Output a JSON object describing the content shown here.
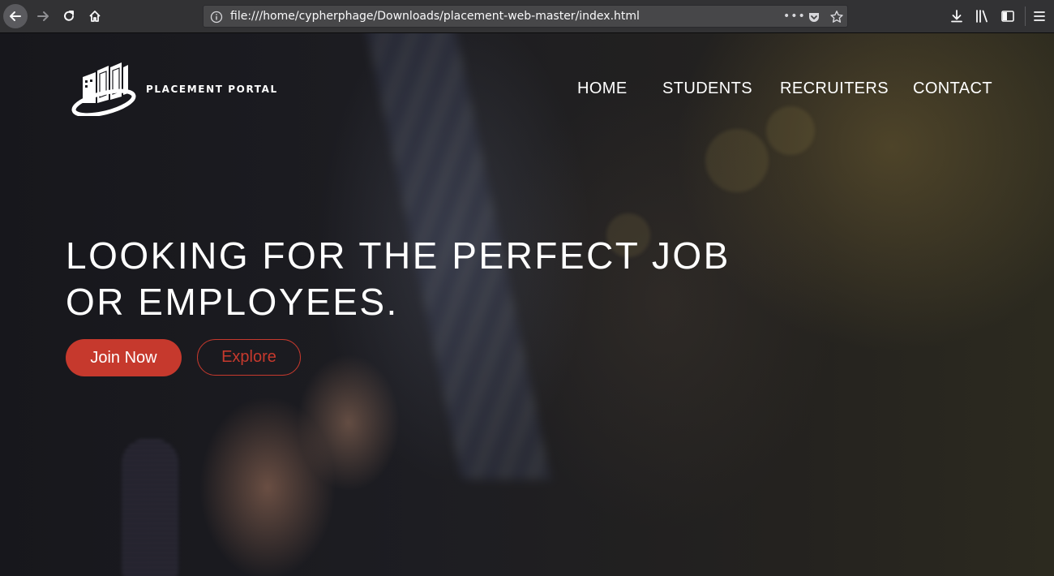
{
  "browser": {
    "url": "file:///home/cypherphage/Downloads/placement-web-master/index.html",
    "more_label": "•••"
  },
  "site": {
    "logo_text": "PLACEMENT PORTAL",
    "nav": [
      "HOME",
      "STUDENTS",
      "RECRUITERS",
      "CONTACT"
    ],
    "headline": "LOOKING FOR THE PERFECT JOB OR EMPLOYEES.",
    "join_label": "Join Now",
    "explore_label": "Explore"
  },
  "colors": {
    "accent": "#c6392d",
    "toolbar": "#323234",
    "urlbar": "#474749"
  }
}
